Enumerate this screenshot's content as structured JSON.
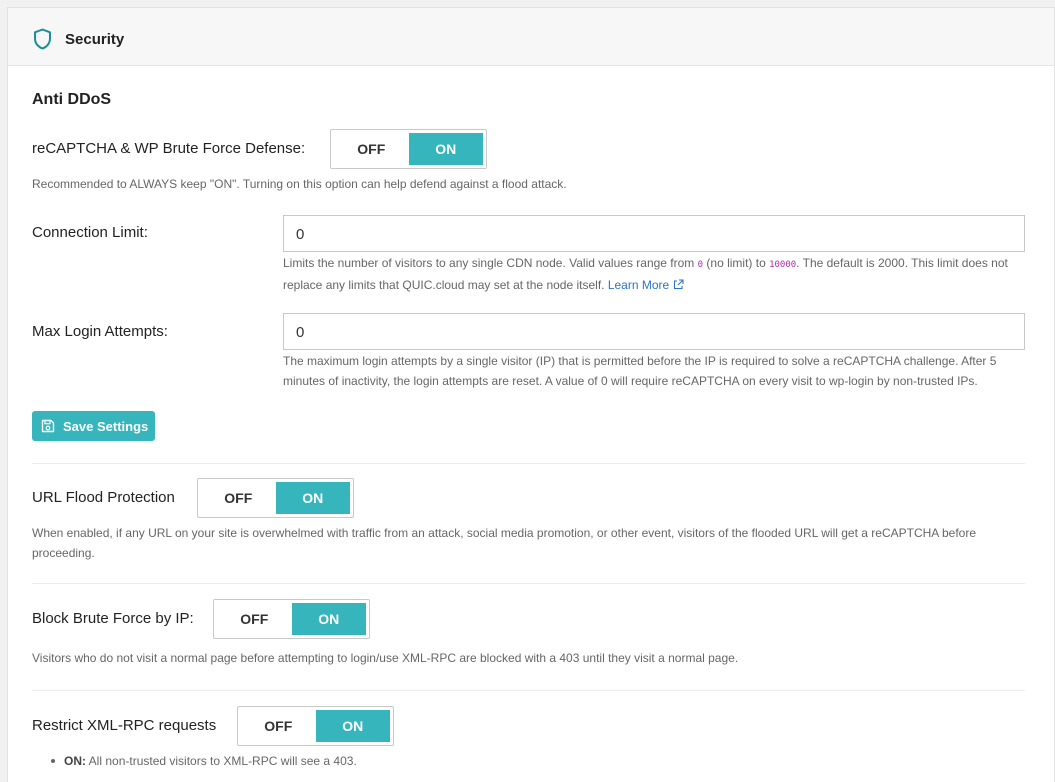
{
  "header": {
    "title": "Security"
  },
  "anti_ddos": {
    "title": "Anti DDoS",
    "recaptcha": {
      "label": "reCAPTCHA & WP Brute Force Defense:",
      "off": "OFF",
      "on": "ON",
      "value": "ON",
      "desc": "Recommended to ALWAYS keep \"ON\". Turning on this option can help defend against a flood attack."
    },
    "connection_limit": {
      "label": "Connection Limit:",
      "value": "0",
      "desc_1": "Limits the number of visitors to any single CDN node. Valid values range from ",
      "code_min": "0",
      "desc_2": " (no limit) to ",
      "code_max": "10000",
      "desc_3": ". The default is 2000. This limit does not replace any limits that QUIC.cloud may set at the node itself. ",
      "learn_more": "Learn More"
    },
    "max_login": {
      "label": "Max Login Attempts:",
      "value": "0",
      "desc": "The maximum login attempts by a single visitor (IP) that is permitted before the IP is required to solve a reCAPTCHA challenge. After 5 minutes of inactivity, the login attempts are reset. A value of 0 will require reCAPTCHA on every visit to wp-login by non-trusted IPs."
    },
    "save_label": "Save Settings"
  },
  "url_flood": {
    "label": "URL Flood Protection",
    "off": "OFF",
    "on": "ON",
    "value": "ON",
    "desc": "When enabled, if any URL on your site is overwhelmed with traffic from an attack, social media promotion, or other event, visitors of the flooded URL will get a reCAPTCHA before proceeding."
  },
  "brute_force_ip": {
    "label": "Block Brute Force by IP:",
    "off": "OFF",
    "on": "ON",
    "value": "ON",
    "desc": "Visitors who do not visit a normal page before attempting to login/use XML-RPC are blocked with a 403 until they visit a normal page."
  },
  "xml_rpc": {
    "label": "Restrict XML-RPC requests",
    "off": "OFF",
    "on": "ON",
    "value": "ON",
    "bullets": [
      {
        "key": "ON:",
        "text": " All non-trusted visitors to XML-RPC will see a 403."
      }
    ]
  },
  "colors": {
    "accent": "#36b5bd",
    "link": "#2a75c7",
    "code": "#b42aa8"
  },
  "icons": {
    "header": "shield-icon",
    "save": "floppy-disk-icon",
    "learn_more": "external-link-icon"
  }
}
